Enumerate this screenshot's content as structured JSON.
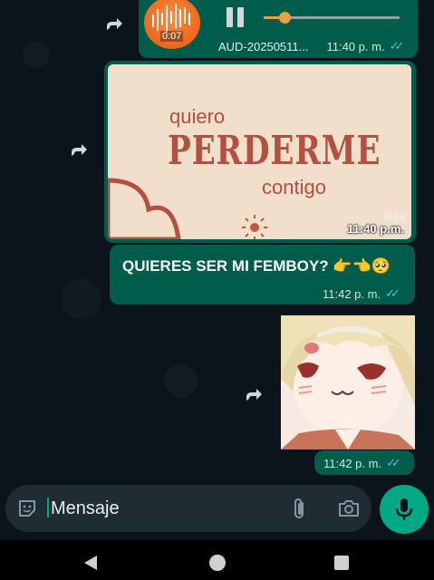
{
  "audio_message": {
    "duration": "0:07",
    "filename": "AUD-20250511...",
    "time": "11:40 p. m.",
    "progress": 0.15
  },
  "image_message": {
    "line1": "quiero",
    "line2": "PERDERME",
    "line3": "contigo",
    "watermark": "TikTok",
    "time": "11:40 p.m."
  },
  "text_message": {
    "text": "QUIERES SER MI FEMBOY? 👉👈🥺",
    "time": "11:42 p. m."
  },
  "sticker_message": {
    "time": "11:42 p. m."
  },
  "composer": {
    "placeholder": "Mensaje"
  },
  "colors": {
    "background": "#0b141a",
    "outgoing_bubble": "#005c4b",
    "accent": "#00a884",
    "read_ticks": "#53bdeb"
  }
}
